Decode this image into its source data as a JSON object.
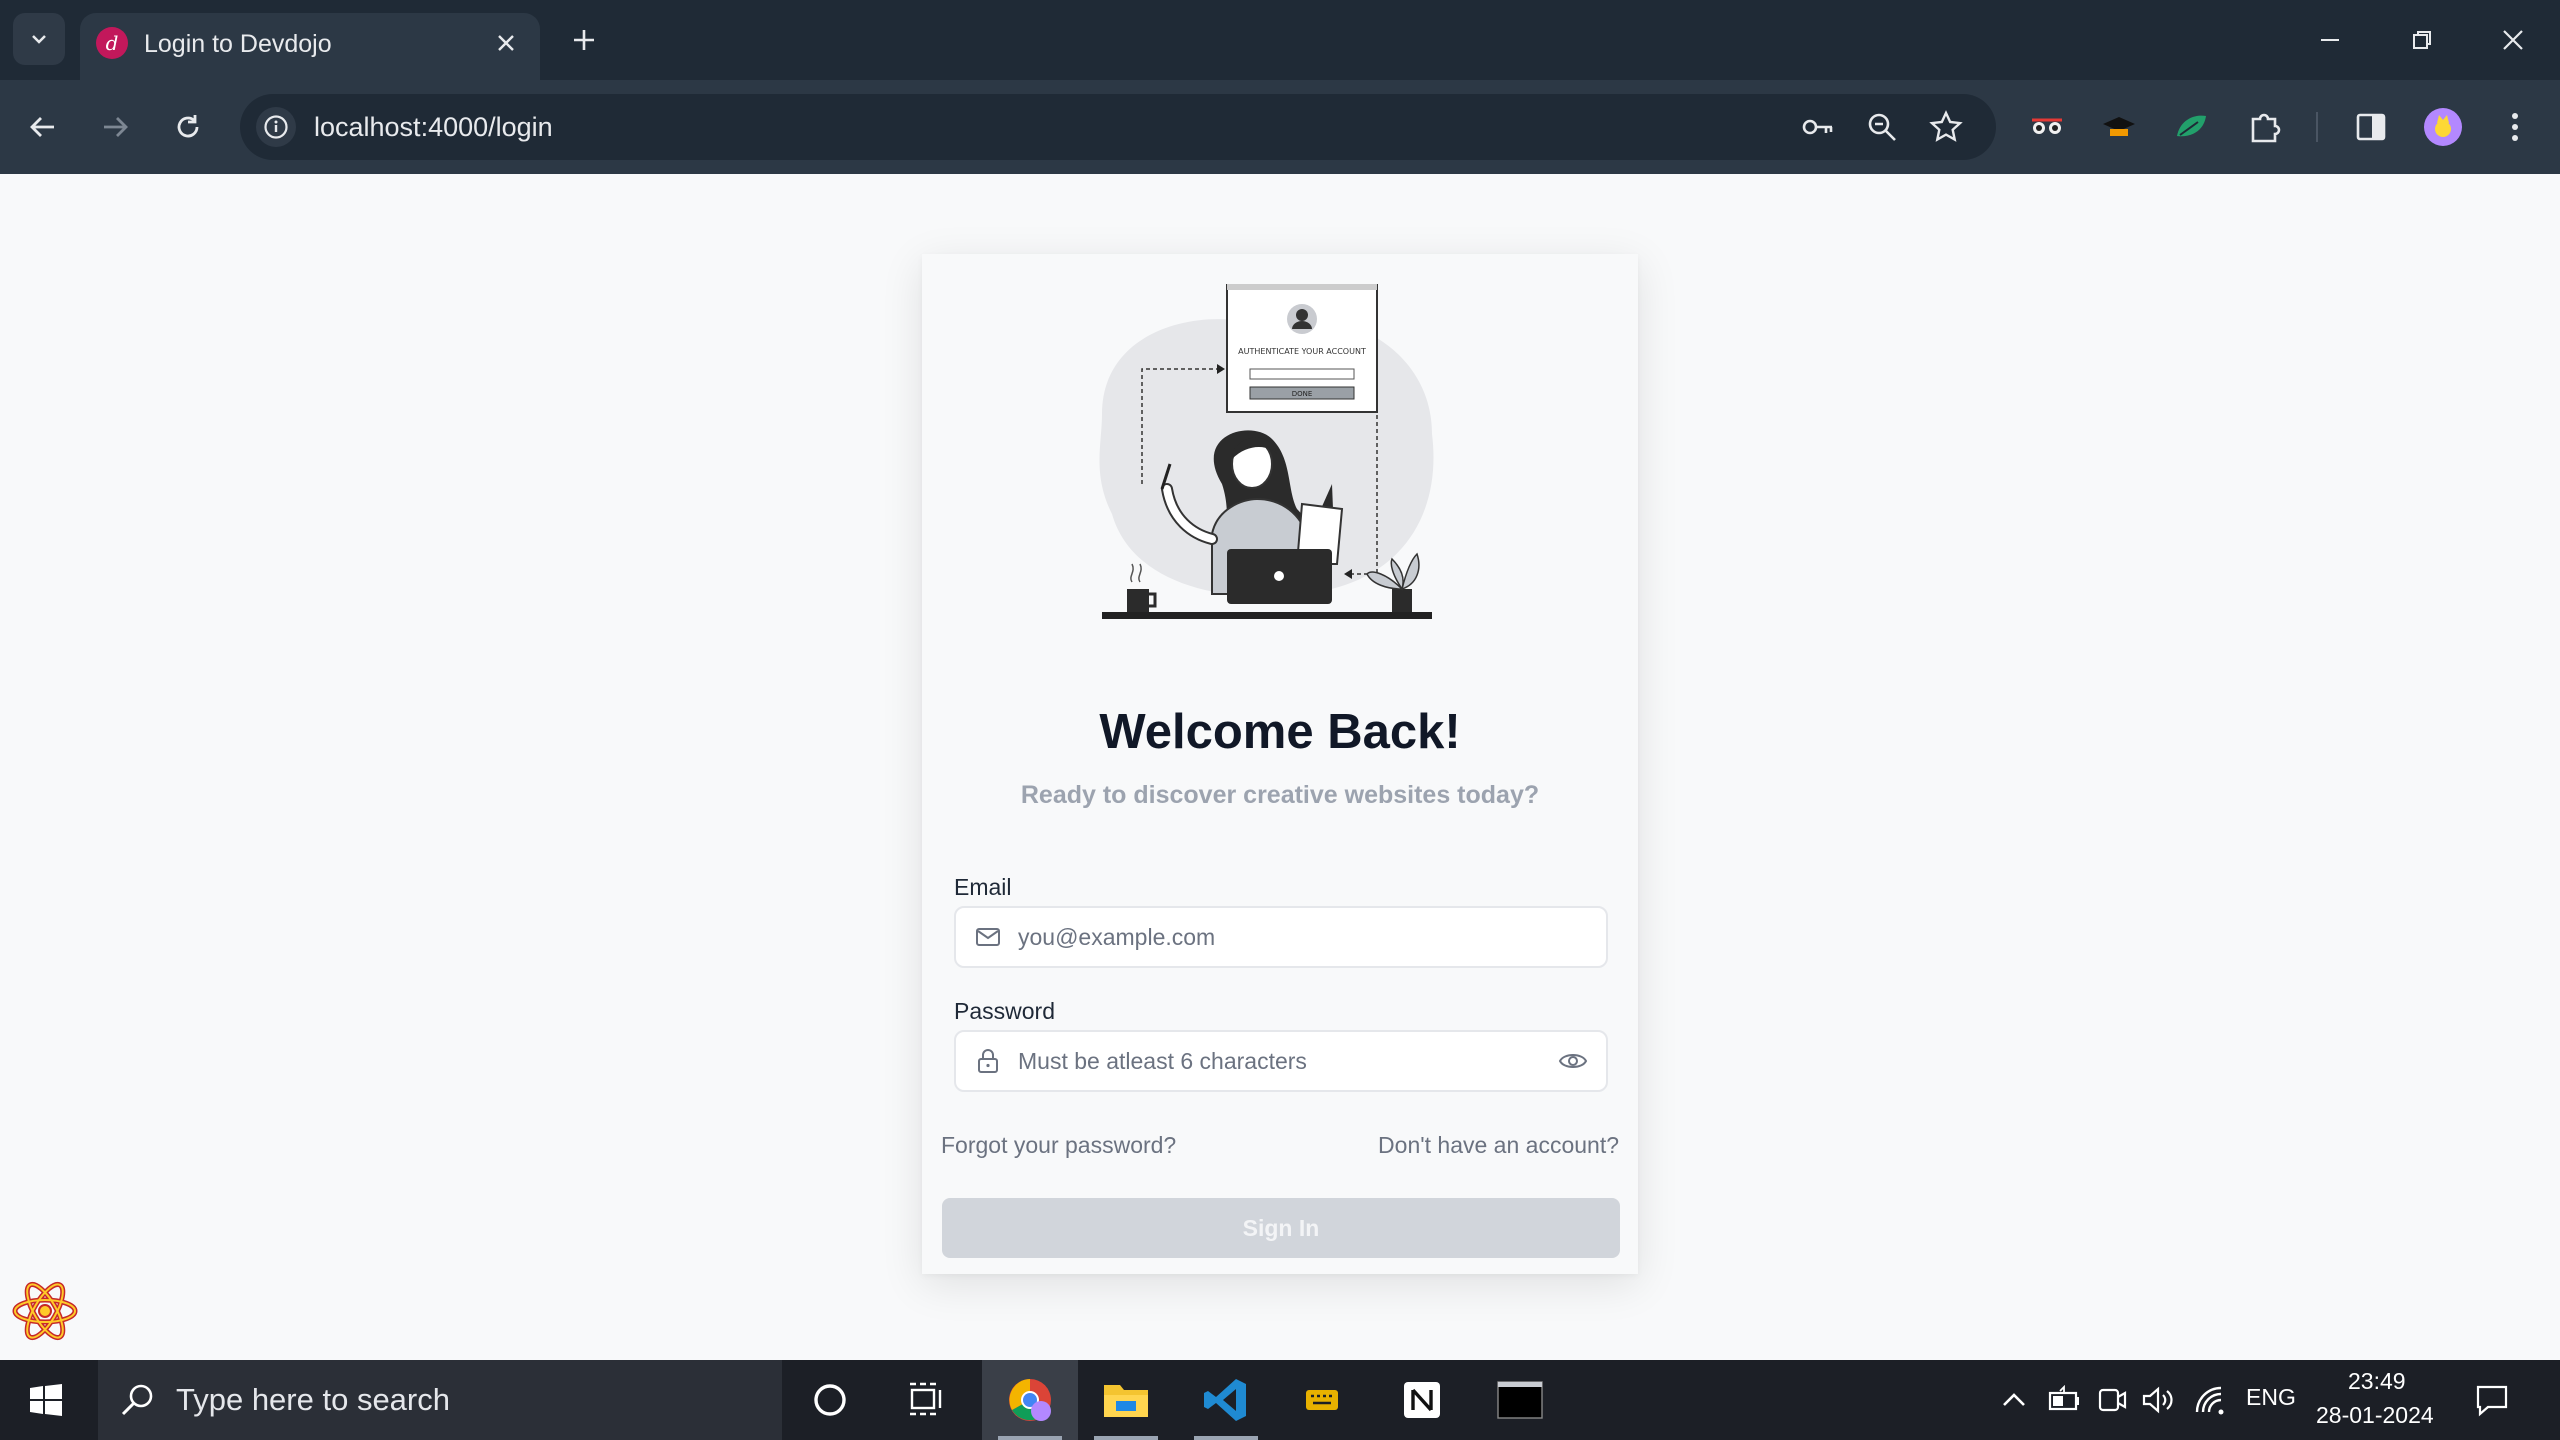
{
  "browser": {
    "tab_title": "Login to Devdojo",
    "favicon_letter": "d",
    "url": "localhost:4000/login"
  },
  "page": {
    "illustration_caption": "AUTHENTICATE YOUR ACCOUNT",
    "illustration_button": "DONE",
    "title": "Welcome Back!",
    "subtitle": "Ready to discover creative websites today?",
    "email": {
      "label": "Email",
      "placeholder": "you@example.com"
    },
    "password": {
      "label": "Password",
      "placeholder": "Must be atleast 6 characters"
    },
    "forgot_link": "Forgot your password?",
    "signup_link": "Don't have an account?",
    "signin_button": "Sign In"
  },
  "taskbar": {
    "search_placeholder": "Type here to search",
    "language": "ENG",
    "time": "23:49",
    "date": "28-01-2024"
  },
  "colors": {
    "chrome_dark": "#1f2a36",
    "chrome_toolbar": "#2c3845",
    "page_bg": "#f8f9fa",
    "button_disabled": "#d1d5db",
    "taskbar": "#1c1f26"
  }
}
